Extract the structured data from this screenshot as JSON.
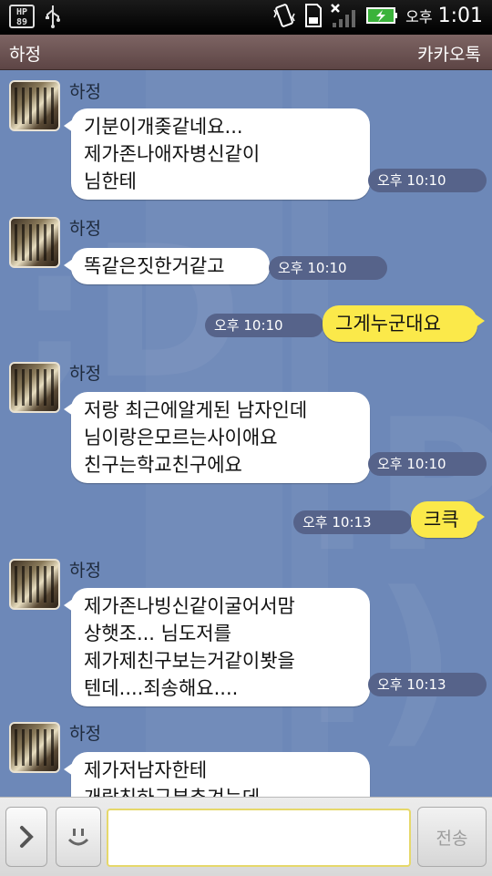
{
  "status_bar": {
    "hp_label_top": "HP",
    "hp_label_bottom": "89",
    "ampm": "오후",
    "time": "1:01",
    "icons": [
      "hp-icon",
      "usb-icon",
      "vibrate-icon",
      "sd-card-icon",
      "signal-icon",
      "battery-charging-icon"
    ]
  },
  "title_bar": {
    "contact": "하정",
    "app": "카카오톡"
  },
  "messages": [
    {
      "sender": "하정",
      "lines": [
        "기분이개좆같네요...",
        "제가존나애자병신같이",
        "님한테"
      ],
      "time": "오후 10:10"
    },
    {
      "sender": "하정",
      "lines": [
        "똑같은짓한거같고"
      ],
      "time": "오후 10:10"
    },
    {
      "lines": [
        "그게누군대요"
      ],
      "time": "오후 10:10"
    },
    {
      "sender": "하정",
      "lines": [
        "저랑 최근에알게된 남자인데",
        "님이랑은모르는사이애요",
        "친구는학교친구에요"
      ],
      "time": "오후 10:10"
    },
    {
      "lines": [
        "크큭"
      ],
      "time": "오후 10:13"
    },
    {
      "sender": "하정",
      "lines": [
        "제가존나빙신같이굴어서맘",
        "상햇조... 님도저를",
        "제가제친구보는거같이봣을",
        "텐데....죄송해요...."
      ],
      "time": "오후 10:13"
    },
    {
      "sender": "하정",
      "lines": [
        "제가저남자한테",
        "개랑친하구부추겨는데"
      ]
    }
  ],
  "input_bar": {
    "placeholder": "",
    "send_label": "전송"
  },
  "colors": {
    "chat_background": "#6d88b8",
    "incoming_bubble": "#ffffff",
    "outgoing_bubble": "#fbe94a",
    "timestamp_pill": "#56638a",
    "title_bar": "#6e5555"
  }
}
